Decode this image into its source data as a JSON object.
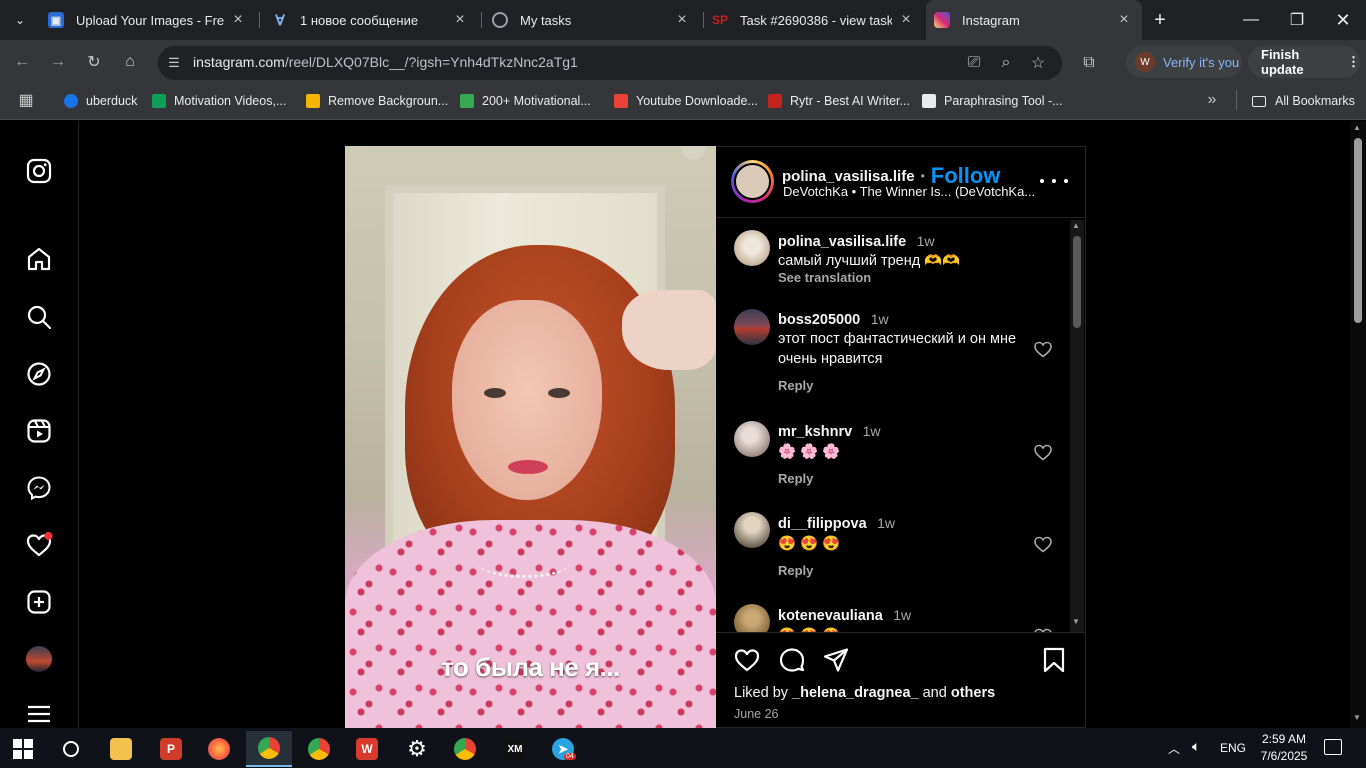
{
  "tabs": [
    {
      "title": "Upload Your Images - Free I",
      "favicon": "image-upload-icon",
      "color": "#2b6bd6"
    },
    {
      "title": "1 новое сообщение",
      "favicon": "v-icon",
      "color": "#8ab4f8"
    },
    {
      "title": "My tasks",
      "favicon": "swirl-icon",
      "color": "#9aa0a6"
    },
    {
      "title": "Task #2690386 - view task",
      "favicon": "sp-icon",
      "color": "#c5221f"
    },
    {
      "title": "Instagram",
      "favicon": "instagram-icon",
      "color": "#d62976",
      "active": true
    }
  ],
  "omnibox": {
    "host": "instagram.com",
    "path": "/reel/DLXQ07Blc__/?igsh=Ynh4dTkzNnc2aTg1"
  },
  "profile": {
    "verify_label": "Verify it's you",
    "finish_label": "Finish update"
  },
  "bookmarks": [
    {
      "label": "uberduck",
      "color": "#1a73e8"
    },
    {
      "label": "Motivation Videos,...",
      "color": "#0f9d58"
    },
    {
      "label": "Remove Backgroun...",
      "color": "#f4b400"
    },
    {
      "label": "200+ Motivational...",
      "color": "#34a853"
    },
    {
      "label": "Youtube Downloade...",
      "color": "#ea4335"
    },
    {
      "label": "Rytr - Best AI Writer...",
      "color": "#c5221f"
    },
    {
      "label": "Paraphrasing Tool -...",
      "color": "#e8eaed"
    }
  ],
  "all_bookmarks_label": "All Bookmarks",
  "post": {
    "username": "polina_vasilisa.life",
    "dot": "•",
    "follow_label": "Follow",
    "audio": "DeVotchKa • The Winner Is... (DeVotchKa...",
    "video_caption": "то была не я...",
    "comments": [
      {
        "user": "polina_vasilisa.life",
        "time": "1w",
        "text": "самый лучший тренд 🫶🫶",
        "extra": "See translation",
        "avatar_color": "#d8c6b3"
      },
      {
        "user": "boss205000",
        "time": "1w",
        "text": "этот пост фантастический и он мне очень нравится",
        "reply": "Reply",
        "avatar_color": "#6a4a55"
      },
      {
        "user": "mr_kshnrv",
        "time": "1w",
        "text": "🌸 🌸 🌸",
        "reply": "Reply",
        "avatar_color": "#b9a9a3"
      },
      {
        "user": "di__filippova",
        "time": "1w",
        "text": "😍 😍 😍",
        "reply": "Reply",
        "avatar_color": "#8a7d6e"
      },
      {
        "user": "kotenevauliana",
        "time": "1w",
        "text": "😍 😍 😍",
        "avatar_color": "#a58a62"
      }
    ],
    "liked_by_prefix": "Liked by ",
    "liked_by_user": "_helena_dragnea_",
    "liked_by_and": " and ",
    "liked_by_others": "others",
    "date": "June 26"
  },
  "taskbar": {
    "lang": "ENG",
    "time": "2:59 AM",
    "date": "7/6/2025",
    "telegram_badge": "04"
  },
  "colors": {
    "accent_follow": "#0095f6",
    "notification_dot": "#ff3040"
  }
}
